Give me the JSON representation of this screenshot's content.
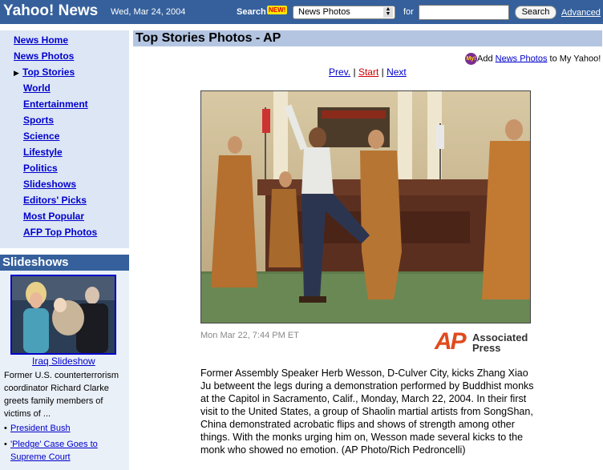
{
  "header": {
    "logo": "Yahoo! News",
    "date": "Wed, Mar 24, 2004",
    "search_label": "Search",
    "new_badge": "NEW!",
    "search_scope": "News Photos",
    "for_label": "for",
    "search_value": "",
    "search_button": "Search",
    "advanced_link": "Advanced"
  },
  "nav": {
    "items": [
      {
        "label": "News Home"
      },
      {
        "label": "News Photos"
      },
      {
        "label": "Top Stories"
      },
      {
        "label": "World"
      },
      {
        "label": "Entertainment"
      },
      {
        "label": "Sports"
      },
      {
        "label": "Science"
      },
      {
        "label": "Lifestyle"
      },
      {
        "label": "Politics"
      },
      {
        "label": "Slideshows"
      },
      {
        "label": "Editors' Picks"
      },
      {
        "label": "Most Popular"
      },
      {
        "label": "AFP Top Photos"
      }
    ],
    "current_marker": "▶"
  },
  "slideshows": {
    "title": "Slideshows",
    "thumb_link": "Iraq Slideshow",
    "description": "Former U.S. counterterrorism coordinator Richard Clarke greets family members of victims of ...",
    "links": [
      "President Bush",
      "'Pledge' Case Goes to",
      "Supreme Court"
    ]
  },
  "main": {
    "title": "Top Stories Photos - AP",
    "add_prefix": "Add",
    "add_link": "News Photos",
    "add_suffix": "to My Yahoo!",
    "y_icon": "My!",
    "pager": {
      "prev": "Prev.",
      "sep1": "|",
      "start": "Start",
      "sep2": "|",
      "next": "Next"
    },
    "photo_date": "Mon Mar 22, 7:44 PM ET",
    "ap_logo": {
      "letters": "AP",
      "line1": "Associated",
      "line2": "Press"
    },
    "story": "Former Assembly Speaker Herb Wesson, D-Culver City, kicks Zhang Xiao Ju betweent the legs during a demonstration performed by Buddhist monks at the Capitol in Sacramento, Calif., Monday, March 22, 2004. In their first visit to the United States, a group of Shaolin martial artists from SongShan, China demonstrated acrobatic flips and shows of strength among other things. With the monks urging him on, Wesson made several kicks to the monk who showed no emotion. (AP Photo/Rich Pedroncelli)"
  },
  "colors": {
    "header_bar": "#35609c",
    "nav_bg": "#dce6f5",
    "title_bar": "#b3c5e1",
    "link": "#0000cc",
    "ap_orange": "#e04a1e"
  }
}
